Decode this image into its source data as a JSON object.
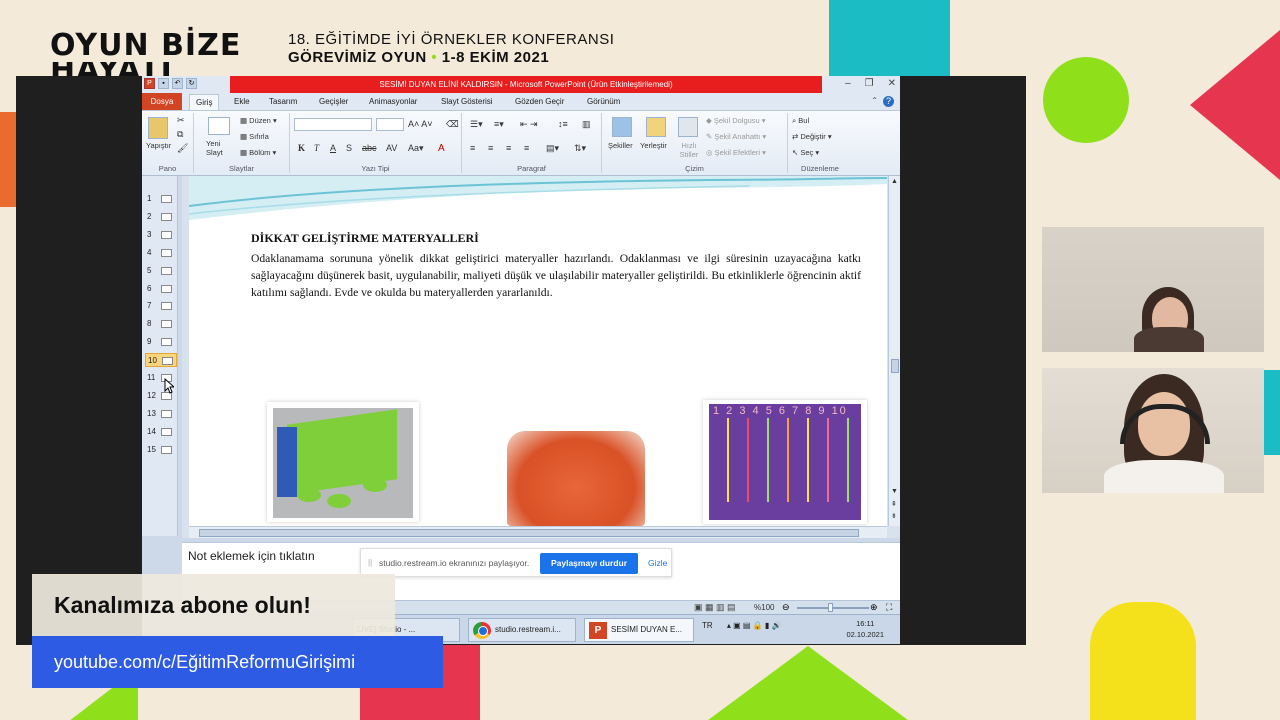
{
  "header": {
    "logo_line1": "OYUN BİZE",
    "logo_line2": "HAYATI",
    "conference_line1": "18. EĞİTİMDE İYİ ÖRNEKLER KONFERANSI",
    "conference_line2_a": "GÖREVİMİZ OYUN",
    "conference_line2_b": "1-8 EKİM 2021"
  },
  "window": {
    "title": "SESİMİ DUYAN ELİNİ KALDIRSIN  -  Microsoft PowerPoint (Ürün Etkinleştirilemedi)"
  },
  "tabs": [
    "Dosya",
    "Giriş",
    "Ekle",
    "Tasarım",
    "Geçişler",
    "Animasyonlar",
    "Slayt Gösterisi",
    "Gözden Geçir",
    "Görünüm"
  ],
  "ribbon": {
    "pano": {
      "paste": "Yapıştır",
      "label": "Pano"
    },
    "slaytlar": {
      "new_slide": "Yeni Slayt",
      "layout": "Düzen",
      "reset": "Sıfırla",
      "section": "Bölüm",
      "label": "Slaytlar"
    },
    "yazi_tipi": {
      "label": "Yazı Tipi"
    },
    "paragraf": {
      "label": "Paragraf"
    },
    "cizim": {
      "shapes": "Şekiller",
      "arrange": "Yerleştir",
      "quick_styles": "Hızlı Stiller",
      "fill": "Şekil Dolgusu",
      "outline": "Şekil Anahattı",
      "effects": "Şekil Efektleri",
      "label": "Çizim"
    },
    "duzenleme": {
      "find": "Bul",
      "replace": "Değiştir",
      "select": "Seç",
      "label": "Düzenleme"
    }
  },
  "thumbnails": [
    "1",
    "2",
    "3",
    "4",
    "5",
    "6",
    "7",
    "8",
    "9",
    "10",
    "11",
    "12",
    "13",
    "14",
    "15"
  ],
  "selected_slide": 10,
  "slide": {
    "heading": "DİKKAT GELİŞTİRME MATERYALLERİ",
    "body": "Odaklanamama sorununa yönelik dikkat geliştirici materyaller hazırlandı. Odaklanması ve ilgi süresinin uzayacağına katkı sağlayacağını düşünerek basit, uygulanabilir, maliyeti düşük ve ulaşılabilir materyaller geliştirildi.  Bu etkinliklerle öğrencinin aktif katılımı sağlandı. Evde ve okulda bu materyallerden  yararlanıldı.",
    "image3_numbers": "1 2 3 4 5 6 7 8 9 10"
  },
  "notes_placeholder": "Not eklemek için tıklatın",
  "share_bar": {
    "grip": "||",
    "text": "studio.restream.io ekranınızı paylaşıyor.",
    "stop_button": "Paylaşmayı durdur",
    "hide_link": "Gizle"
  },
  "status": {
    "zoom": "%100"
  },
  "taskbar": {
    "items": [
      "LIVE] Studio - ...",
      "studio.restream.i...",
      "SESİMİ DUYAN E..."
    ],
    "lang": "TR",
    "time": "16:11",
    "date": "02.10.2021"
  },
  "overlay": {
    "subscribe": "Kanalımıza abone olun!",
    "url": "youtube.com/c/EğitimReformuGirişimi"
  },
  "colors": {
    "brand_blue": "#2d5be3",
    "accent_green": "#8fe01a",
    "accent_red": "#e6364f",
    "accent_teal": "#1bbcc3",
    "accent_yellow": "#f5e11b",
    "ppt_title_red": "#e81e1e"
  }
}
